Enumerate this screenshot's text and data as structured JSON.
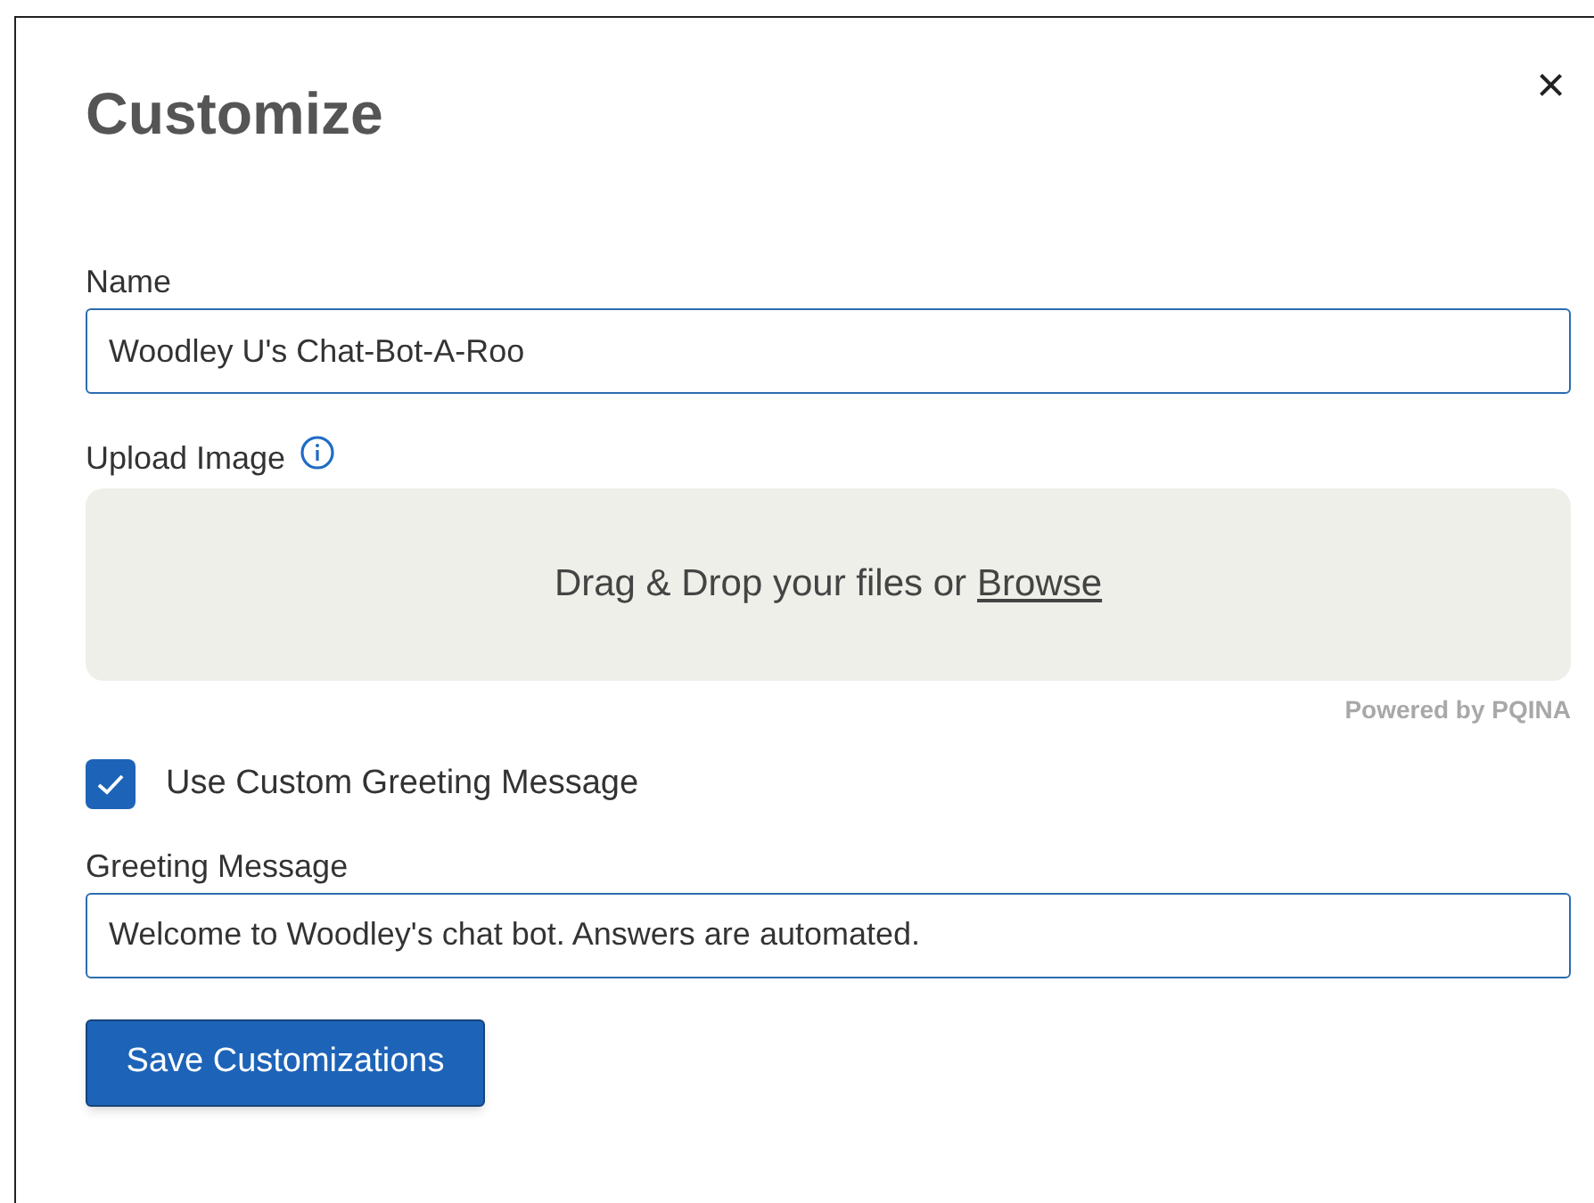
{
  "dialog": {
    "title": "Customize",
    "close": "×"
  },
  "name_field": {
    "label": "Name",
    "value": "Woodley U's Chat-Bot-A-Roo"
  },
  "upload": {
    "label": "Upload Image",
    "drop_text": "Drag & Drop your files or",
    "browse_link": "Browse",
    "credit": "Powered by PQINA"
  },
  "custom_greeting": {
    "label": "Use Custom Greeting Message",
    "checked": true
  },
  "greeting_field": {
    "label": "Greeting Message",
    "value": "Welcome to Woodley's chat bot. Answers are automated."
  },
  "save_button": "Save Customizations"
}
